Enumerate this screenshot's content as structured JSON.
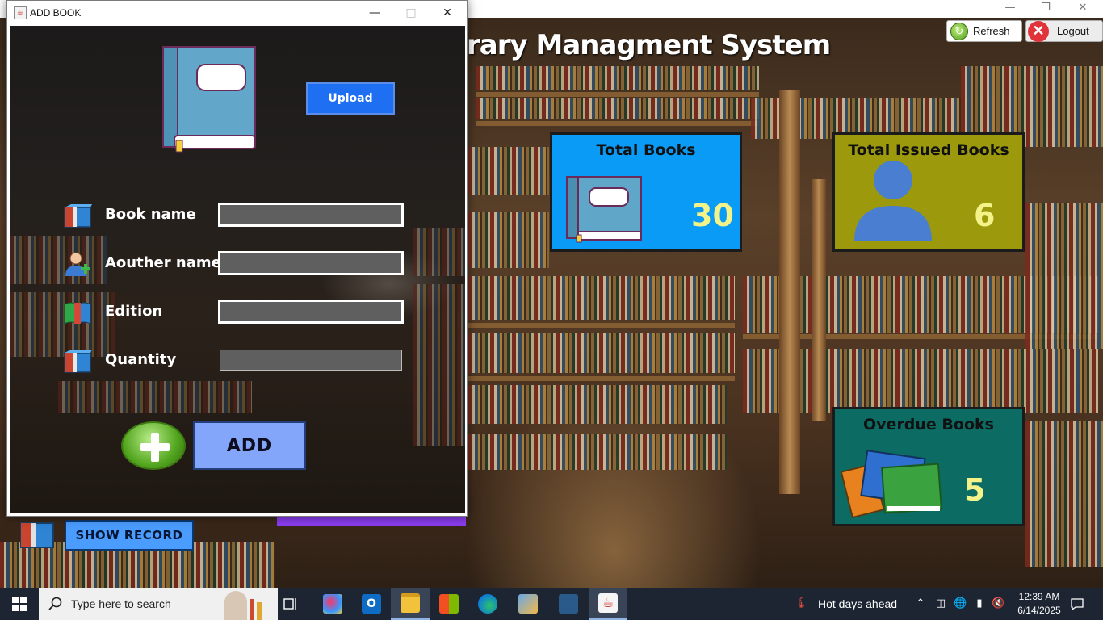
{
  "main": {
    "title": "rary Managment System",
    "refresh_label": "Refresh",
    "logout_label": "Logout",
    "show_record_label": "SHOW RECORD",
    "cards": {
      "total_books": {
        "title": "Total Books",
        "value": "30",
        "color": "#0a9bf6"
      },
      "total_issued": {
        "title": "Total Issued Books",
        "value": "6",
        "color": "#9c9a0c"
      },
      "overdue": {
        "title": "Overdue Books",
        "value": "5",
        "color": "#0c6b63"
      }
    }
  },
  "dialog": {
    "title": "ADD BOOK",
    "upload_label": "Upload",
    "fields": [
      {
        "label": "Book name",
        "value": "",
        "icon": "books-icon"
      },
      {
        "label": "Aouther name",
        "value": "",
        "icon": "author-icon"
      },
      {
        "label": "Edition",
        "value": "",
        "icon": "open-book-icon"
      },
      {
        "label": "Quantity",
        "value": "",
        "icon": "books-icon"
      }
    ],
    "add_label": "ADD"
  },
  "taskbar": {
    "search_placeholder": "Type here to search",
    "weather_text": "Hot days ahead",
    "time": "12:39 AM",
    "date": "6/14/2025"
  },
  "colors": {
    "accent_blue": "#1e6ff2",
    "add_button": "#83a6fb",
    "show_record": "#4b9cff",
    "value_text": "#f4f38a"
  }
}
